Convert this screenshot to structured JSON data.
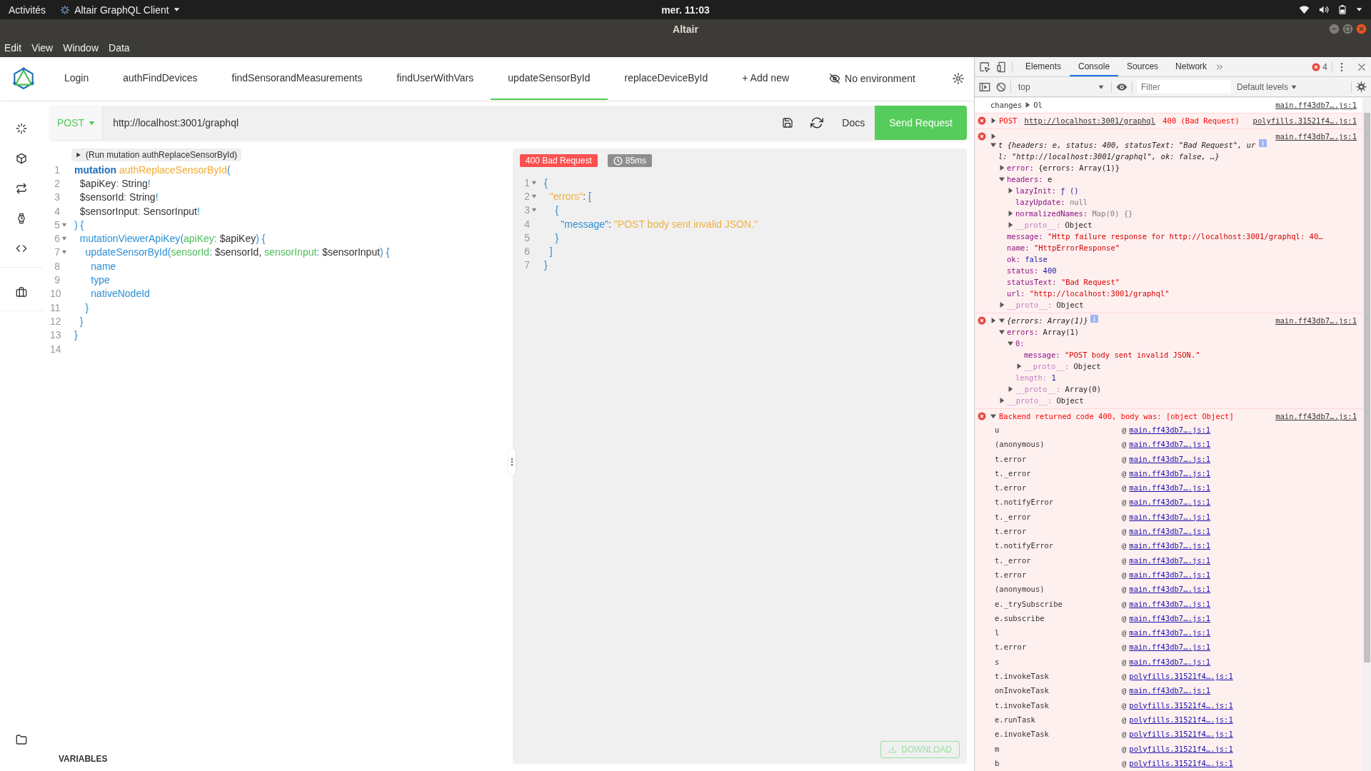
{
  "system_bar": {
    "activities": "Activités",
    "app_menu": "Altair GraphQL Client",
    "clock": "mer. 11:03"
  },
  "window": {
    "title": "Altair"
  },
  "menu_bar": [
    "Edit",
    "View",
    "Window",
    "Data"
  ],
  "altair": {
    "tabs": [
      {
        "label": "Login",
        "selected": false
      },
      {
        "label": "authFindDevices",
        "selected": false
      },
      {
        "label": "findSensorandMeasurements",
        "selected": false
      },
      {
        "label": "findUserWithVars",
        "selected": false
      },
      {
        "label": "updateSensorById",
        "selected": true
      },
      {
        "label": "replaceDeviceById",
        "selected": false
      }
    ],
    "add_tab": "+ Add new",
    "environment": "No environment",
    "request": {
      "method": "POST",
      "url": "http://localhost:3001/graphql",
      "docs": "Docs",
      "send": "Send Request"
    },
    "editor": {
      "run_hint": "(Run mutation authReplaceSensorById)",
      "lines": [
        {
          "number": "1",
          "foldable": false,
          "tokens": [
            {
              "kind": "keyword",
              "text": "mutation "
            },
            {
              "kind": "def",
              "text": "authReplaceSensorById"
            },
            {
              "kind": "punct",
              "text": "("
            }
          ]
        },
        {
          "number": "2",
          "foldable": false,
          "tokens": [
            {
              "kind": "var",
              "text": "  $apiKey"
            },
            {
              "kind": "punct",
              "text": ": "
            },
            {
              "kind": "var",
              "text": "String"
            },
            {
              "kind": "punct",
              "text": "!"
            }
          ]
        },
        {
          "number": "3",
          "foldable": false,
          "tokens": [
            {
              "kind": "var",
              "text": "  $sensorId"
            },
            {
              "kind": "punct",
              "text": ": "
            },
            {
              "kind": "var",
              "text": "String"
            },
            {
              "kind": "punct",
              "text": "!"
            }
          ]
        },
        {
          "number": "4",
          "foldable": false,
          "tokens": [
            {
              "kind": "var",
              "text": "  $sensorInput"
            },
            {
              "kind": "punct",
              "text": ": "
            },
            {
              "kind": "var",
              "text": "SensorInput"
            },
            {
              "kind": "punct",
              "text": "!"
            }
          ]
        },
        {
          "number": "5",
          "foldable": true,
          "tokens": [
            {
              "kind": "punct",
              "text": ") {"
            }
          ]
        },
        {
          "number": "6",
          "foldable": true,
          "tokens": [
            {
              "kind": "field",
              "text": "  mutationViewerApiKey"
            },
            {
              "kind": "punct",
              "text": "("
            },
            {
              "kind": "attr",
              "text": "apiKey"
            },
            {
              "kind": "punct",
              "text": ": "
            },
            {
              "kind": "var",
              "text": "$apiKey"
            },
            {
              "kind": "punct",
              "text": ") {"
            }
          ]
        },
        {
          "number": "7",
          "foldable": true,
          "tokens": [
            {
              "kind": "field",
              "text": "    updateSensorById"
            },
            {
              "kind": "punct",
              "text": "("
            },
            {
              "kind": "attr",
              "text": "sensorId"
            },
            {
              "kind": "punct",
              "text": ": "
            },
            {
              "kind": "var",
              "text": "$sensorId, "
            },
            {
              "kind": "attr",
              "text": "sensorInput"
            },
            {
              "kind": "punct",
              "text": ": "
            },
            {
              "kind": "var",
              "text": "$sensorInput"
            },
            {
              "kind": "punct",
              "text": ") {"
            }
          ]
        },
        {
          "number": "8",
          "foldable": false,
          "tokens": [
            {
              "kind": "field",
              "text": "      name"
            }
          ]
        },
        {
          "number": "9",
          "foldable": false,
          "tokens": [
            {
              "kind": "field",
              "text": "      type"
            }
          ]
        },
        {
          "number": "10",
          "foldable": false,
          "tokens": [
            {
              "kind": "field",
              "text": "      nativeNodeId"
            }
          ]
        },
        {
          "number": "11",
          "foldable": false,
          "tokens": [
            {
              "kind": "punct",
              "text": "    }"
            }
          ]
        },
        {
          "number": "12",
          "foldable": false,
          "tokens": [
            {
              "kind": "punct",
              "text": "  }"
            }
          ]
        },
        {
          "number": "13",
          "foldable": false,
          "tokens": [
            {
              "kind": "punct",
              "text": "}"
            }
          ]
        },
        {
          "number": "14",
          "foldable": false
        }
      ]
    },
    "response": {
      "status": "400 Bad Request",
      "time": "85ms",
      "lines": [
        {
          "number": "1",
          "foldable": true,
          "tokens": [
            {
              "kind": "punct",
              "text": "{"
            }
          ]
        },
        {
          "number": "2",
          "foldable": true,
          "tokens": [
            {
              "kind": "string",
              "text": "  \"errors\""
            },
            {
              "kind": "colon",
              "text": ": "
            },
            {
              "kind": "punct",
              "text": "["
            }
          ]
        },
        {
          "number": "3",
          "foldable": true,
          "tokens": [
            {
              "kind": "punct",
              "text": "    {"
            }
          ]
        },
        {
          "number": "4",
          "foldable": false,
          "tokens": [
            {
              "kind": "field",
              "text": "      \"message\""
            },
            {
              "kind": "colon",
              "text": ": "
            },
            {
              "kind": "string",
              "text": "\"POST body sent invalid JSON.\""
            }
          ]
        },
        {
          "number": "5",
          "foldable": false,
          "tokens": [
            {
              "kind": "punct",
              "text": "    }"
            }
          ]
        },
        {
          "number": "6",
          "foldable": false,
          "tokens": [
            {
              "kind": "punct",
              "text": "  ]"
            }
          ]
        },
        {
          "number": "7",
          "foldable": false,
          "tokens": [
            {
              "kind": "punct",
              "text": "}"
            }
          ]
        }
      ],
      "download": "DOWNLOAD"
    },
    "variables_label": "VARIABLES"
  },
  "devtools": {
    "tabs": [
      {
        "label": "Elements",
        "selected": false
      },
      {
        "label": "Console",
        "selected": true
      },
      {
        "label": "Sources",
        "selected": false
      },
      {
        "label": "Network",
        "selected": false
      }
    ],
    "error_count": "4",
    "context": "top",
    "filter_placeholder": "Filter",
    "levels": "Default levels",
    "messages": [
      {
        "kind": "log",
        "source": "main.ff43db7….js:1",
        "segments": [
          {
            "kind": "text",
            "text": "changes"
          },
          {
            "kind": "toggle",
            "expanded": false
          },
          {
            "kind": "text",
            "text": "Ol"
          }
        ]
      },
      {
        "kind": "error",
        "source": "polyfills.31521f4….js:1",
        "segments": [
          {
            "kind": "toggle",
            "expanded": false
          },
          {
            "kind": "text",
            "text": "POST "
          },
          {
            "kind": "link",
            "text": "http://localhost:3001/graphql"
          },
          {
            "kind": "text",
            "text": " 400 (Bad Request)"
          }
        ]
      },
      {
        "kind": "error",
        "source": "main.ff43db7….js:1",
        "segments": [
          {
            "kind": "toggle",
            "expanded": false
          }
        ],
        "tree": {
          "label": "t {headers: e, status: 400, statusText: \"Bad Request\", url: \"http://localhost:3001/graphql\", ok: false, …}",
          "expanded": true,
          "children": [
            {
              "key": "error:",
              "value": "{errors: Array(1)}",
              "kind": "object",
              "expanded": false
            },
            {
              "key": "headers:",
              "value": "e",
              "kind": "object",
              "expanded": true,
              "children": [
                {
                  "key": "lazyInit:",
                  "value": "ƒ ()",
                  "kind": "function",
                  "expanded": false
                },
                {
                  "key": "lazyUpdate:",
                  "value": "null",
                  "kind": "null"
                },
                {
                  "key": "normalizedNames:",
                  "value": "Map(0) {}",
                  "kind": "map",
                  "expanded": false
                },
                {
                  "key": "__proto__:",
                  "value": "Object",
                  "kind": "object",
                  "dim": true,
                  "expanded": false
                }
              ]
            },
            {
              "key": "message:",
              "value": "\"Http failure response for http://localhost:3001/graphql: 40…",
              "kind": "string"
            },
            {
              "key": "name:",
              "value": "\"HttpErrorResponse\"",
              "kind": "string"
            },
            {
              "key": "ok:",
              "value": "false",
              "kind": "number"
            },
            {
              "key": "status:",
              "value": "400",
              "kind": "number"
            },
            {
              "key": "statusText:",
              "value": "\"Bad Request\"",
              "kind": "string"
            },
            {
              "key": "url:",
              "value": "\"http://localhost:3001/graphql\"",
              "kind": "string"
            },
            {
              "key": "__proto__:",
              "value": "Object",
              "kind": "object",
              "dim": true,
              "expanded": false
            }
          ]
        }
      },
      {
        "kind": "error",
        "source": "main.ff43db7….js:1",
        "segments": [
          {
            "kind": "toggle",
            "expanded": false
          }
        ],
        "tree": {
          "label": "{errors: Array(1)}",
          "expanded": true,
          "children": [
            {
              "key": "errors:",
              "value": "Array(1)",
              "kind": "object",
              "expanded": true,
              "children": [
                {
                  "key": "0:",
                  "expanded": true,
                  "children": [
                    {
                      "key": "message:",
                      "value": "\"POST body sent invalid JSON.\"",
                      "kind": "string"
                    },
                    {
                      "key": "__proto__:",
                      "value": "Object",
                      "kind": "object",
                      "dim": true,
                      "expanded": false
                    }
                  ]
                },
                {
                  "key": "length:",
                  "value": "1",
                  "kind": "number",
                  "dim": true
                },
                {
                  "key": "__proto__:",
                  "value": "Array(0)",
                  "kind": "object",
                  "dim": true,
                  "expanded": false
                }
              ]
            },
            {
              "key": "__proto__:",
              "value": "Object",
              "kind": "object",
              "dim": true,
              "expanded": false
            }
          ]
        }
      },
      {
        "kind": "error",
        "source": "main.ff43db7….js:1",
        "segments": [
          {
            "kind": "toggle",
            "expanded": true
          },
          {
            "kind": "text",
            "text": "Backend returned code 400, body was: [object Object]"
          }
        ],
        "stack": [
          {
            "function": "u",
            "at": "@",
            "source": "main.ff43db7….js:1"
          },
          {
            "function": "(anonymous)",
            "at": "@",
            "source": "main.ff43db7….js:1"
          },
          {
            "function": "t.error",
            "at": "@",
            "source": "main.ff43db7….js:1"
          },
          {
            "function": "t._error",
            "at": "@",
            "source": "main.ff43db7….js:1"
          },
          {
            "function": "t.error",
            "at": "@",
            "source": "main.ff43db7….js:1"
          },
          {
            "function": "t.notifyError",
            "at": "@",
            "source": "main.ff43db7….js:1"
          },
          {
            "function": "t._error",
            "at": "@",
            "source": "main.ff43db7….js:1"
          },
          {
            "function": "t.error",
            "at": "@",
            "source": "main.ff43db7….js:1"
          },
          {
            "function": "t.notifyError",
            "at": "@",
            "source": "main.ff43db7….js:1"
          },
          {
            "function": "t._error",
            "at": "@",
            "source": "main.ff43db7….js:1"
          },
          {
            "function": "t.error",
            "at": "@",
            "source": "main.ff43db7….js:1"
          },
          {
            "function": "(anonymous)",
            "at": "@",
            "source": "main.ff43db7….js:1"
          },
          {
            "function": "e._trySubscribe",
            "at": "@",
            "source": "main.ff43db7….js:1"
          },
          {
            "function": "e.subscribe",
            "at": "@",
            "source": "main.ff43db7….js:1"
          },
          {
            "function": "l",
            "at": "@",
            "source": "main.ff43db7….js:1"
          },
          {
            "function": "t.error",
            "at": "@",
            "source": "main.ff43db7….js:1"
          },
          {
            "function": "s",
            "at": "@",
            "source": "main.ff43db7….js:1"
          },
          {
            "function": "t.invokeTask",
            "at": "@",
            "source": "polyfills.31521f4….js:1"
          },
          {
            "function": "onInvokeTask",
            "at": "@",
            "source": "main.ff43db7….js:1"
          },
          {
            "function": "t.invokeTask",
            "at": "@",
            "source": "polyfills.31521f4….js:1"
          },
          {
            "function": "e.runTask",
            "at": "@",
            "source": "polyfills.31521f4….js:1"
          },
          {
            "function": "e.invokeTask",
            "at": "@",
            "source": "polyfills.31521f4….js:1"
          },
          {
            "function": "m",
            "at": "@",
            "source": "polyfills.31521f4….js:1"
          },
          {
            "function": "b",
            "at": "@",
            "source": "polyfills.31521f4….js:1"
          }
        ]
      }
    ]
  }
}
